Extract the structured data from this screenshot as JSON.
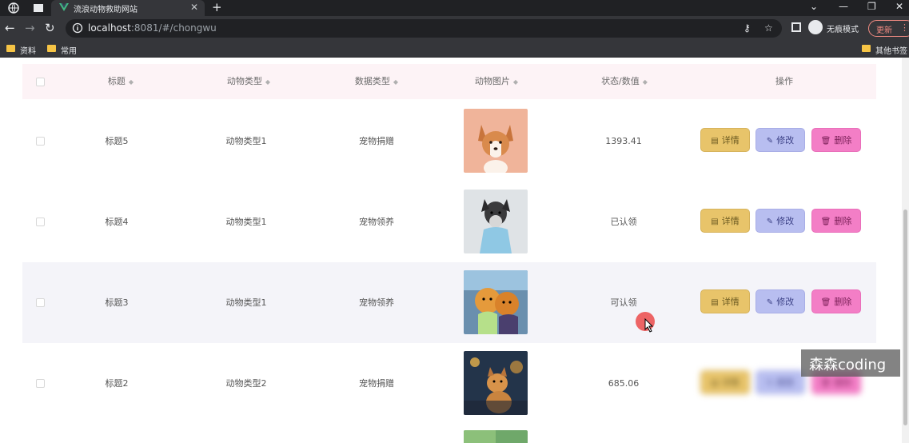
{
  "browser": {
    "tab_title": "流浪动物救助网站",
    "url_host": "localhost",
    "url_rest": ":8081/#/chongwu",
    "incognito_label": "无痕模式",
    "update_label": "更新",
    "bookmarks": [
      "资料",
      "常用"
    ],
    "other_bookmarks": "其他书签"
  },
  "table": {
    "headers": {
      "title": "标题",
      "animal_type": "动物类型",
      "data_type": "数据类型",
      "image": "动物图片",
      "status": "状态/数值",
      "actions": "操作"
    },
    "rows": [
      {
        "title": "标题5",
        "animal_type": "动物类型1",
        "data_type": "宠物捐赠",
        "status": "1393.41",
        "image": "corgi"
      },
      {
        "title": "标题4",
        "animal_type": "动物类型1",
        "data_type": "宠物领养",
        "status": "已认领",
        "image": "schnauzer"
      },
      {
        "title": "标题3",
        "animal_type": "动物类型1",
        "data_type": "宠物领养",
        "status": "可认领",
        "image": "pomeranians"
      },
      {
        "title": "标题2",
        "animal_type": "动物类型2",
        "data_type": "宠物捐赠",
        "status": "685.06",
        "image": "dog-night"
      }
    ],
    "actions": {
      "detail": "详情",
      "edit": "修改",
      "delete": "删除"
    }
  },
  "watermark": "森森coding",
  "colors": {
    "header_bg": "#fdf3f6",
    "detail_btn": "#e8c46a",
    "edit_btn": "#b8bef0",
    "delete_btn": "#f37ec6"
  }
}
